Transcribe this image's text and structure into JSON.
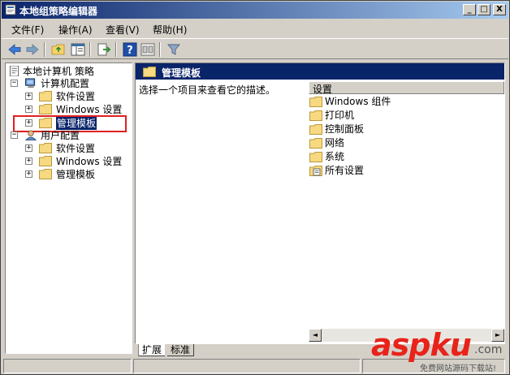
{
  "window": {
    "title": "本地组策略编辑器",
    "controls": {
      "minimize": "_",
      "maximize": "□",
      "close": "X"
    }
  },
  "menubar": {
    "items": [
      {
        "label": "文件(F)"
      },
      {
        "label": "操作(A)"
      },
      {
        "label": "查看(V)"
      },
      {
        "label": "帮助(H)"
      }
    ]
  },
  "toolbar": {
    "icons": [
      "back-arrow-icon",
      "forward-arrow-icon",
      "up-folder-icon",
      "show-hide-tree-icon",
      "export-list-icon",
      "help-icon",
      "console-icon",
      "filter-icon"
    ]
  },
  "tree": {
    "root": "本地计算机 策略",
    "computer_config": "计算机配置",
    "computer_children": [
      "软件设置",
      "Windows 设置",
      "管理模板"
    ],
    "user_config": "用户配置",
    "user_children": [
      "软件设置",
      "Windows 设置",
      "管理模板"
    ],
    "expander_plus": "+",
    "expander_minus": "−"
  },
  "right_pane": {
    "header_title": "管理模板",
    "description": "选择一个项目来查看它的描述。",
    "column_header": "设置",
    "items": [
      {
        "label": "Windows 组件",
        "icon": "folder-icon"
      },
      {
        "label": "打印机",
        "icon": "folder-icon"
      },
      {
        "label": "控制面板",
        "icon": "folder-icon"
      },
      {
        "label": "网络",
        "icon": "folder-icon"
      },
      {
        "label": "系统",
        "icon": "folder-icon"
      },
      {
        "label": "所有设置",
        "icon": "all-settings-icon"
      }
    ],
    "scroll_left": "◄",
    "scroll_right": "►"
  },
  "tabs": [
    {
      "label": "扩展",
      "active": true
    },
    {
      "label": "标准",
      "active": false
    }
  ],
  "watermark": {
    "brand": "aspku",
    "domain": ".com",
    "tagline": "免费网站源码下载站!"
  },
  "colors": {
    "title_bar": "#0a246a",
    "highlight_box": "#e02020",
    "watermark_red": "#e8231a"
  }
}
